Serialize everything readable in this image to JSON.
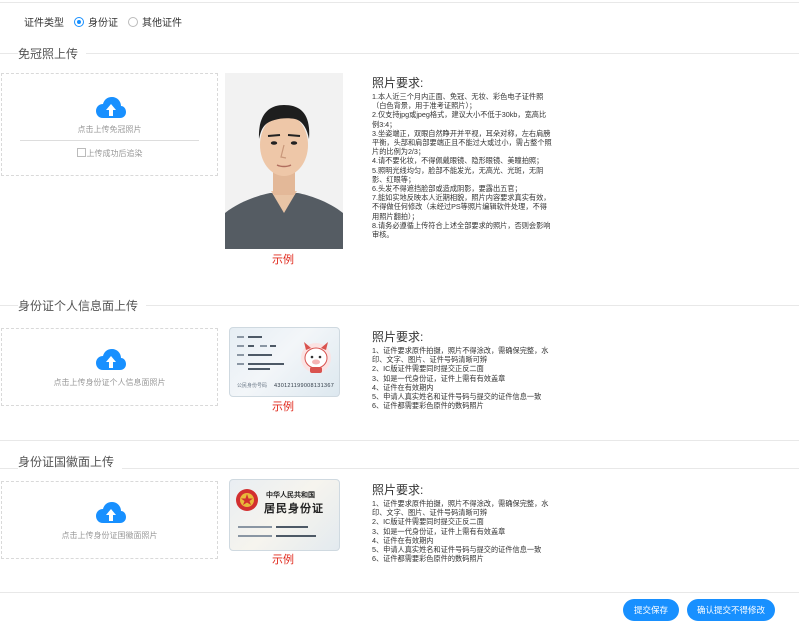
{
  "doc_type": {
    "label": "证件类型",
    "options": [
      {
        "label": "身份证",
        "selected": true
      },
      {
        "label": "其他证件",
        "selected": false
      }
    ]
  },
  "sections": {
    "photo": {
      "title": "免冠照上传",
      "upload_label": "点击上传免冠照片",
      "preview_alt": "上传成功后追染",
      "example": "示例",
      "req_title": "照片要求:",
      "requirements": [
        "1.本人近三个月内正面、免冠、无妆、彩色电子证件照（白色背景，用于准考证照片）；",
        "2.仅支持jpg或jpeg格式，建议大小不低于30kb，宽高比例3:4；",
        "3.坐姿端正，双眼自然睁开并平视，耳朵对称，左右肩膀平衡，头部和肩部要端正且不能过大或过小，需占整个照片的比例为2/3；",
        "4.请不要化妆，不得佩戴眼镜、隐形眼镜、美瞳拍照；",
        "5.照明光线均匀，脸部不能发光，无高光、光斑，无阴影、红眼等；",
        "6.头发不得遮挡脸部或造成阴影，要露出五官；",
        "7.能如实地反映本人近期相貌，照片内容要求真实有效，不得做任何修改（未经过PS等照片编辑软件处理，不得用照片翻拍）；",
        "8.请务必遵循上传符合上述全部要求的照片，否则会影响审核。"
      ]
    },
    "id_front": {
      "title": "身份证个人信息面上传",
      "upload_label": "点击上传身份证个人信息面照片",
      "example": "示例",
      "card_number": "430121199008131367",
      "req_title": "照片要求:",
      "requirements": [
        "1、证件要求原件拍摄，照片不得涂改，需确保完整，水印、文字、图片、证件号码清晰可辨",
        "2、IC版证件需要同时提交正反二面",
        "3、如是一代身份证，证件上需有有效盖章",
        "4、证件在有效期内",
        "5、申请人真实姓名和证件号码与提交的证件信息一致",
        "6、证件都需要彩色原件的数码照片"
      ]
    },
    "id_back": {
      "title": "身份证国徽面上传",
      "upload_label": "点击上传身份证国徽面照片",
      "example": "示例",
      "card_line1": "中华人民共和国",
      "card_line2": "居民身份证",
      "req_title": "照片要求:",
      "requirements": [
        "1、证件要求原件拍摄，照片不得涂改，需确保完整，水印、文字、图片、证件号码清晰可辨",
        "2、IC版证件需要同时提交正反二面",
        "3、如是一代身份证，证件上需有有效盖章",
        "4、证件在有效期内",
        "5、申请人真实姓名和证件号码与提交的证件信息一致",
        "6、证件都需要彩色原件的数码照片"
      ]
    }
  },
  "buttons": {
    "save": "提交保存",
    "confirm": "确认提交不得修改"
  },
  "colors": {
    "accent": "#1890ff",
    "example": "#e0281b"
  }
}
